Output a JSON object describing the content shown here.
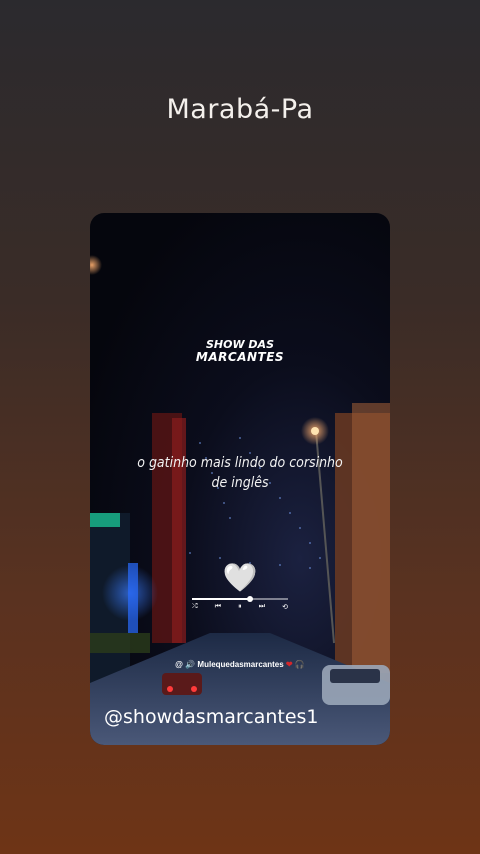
{
  "location": "Marabá-Pa",
  "post": {
    "logo_line1": "SHOW DAS",
    "logo_line2": "MARCANTES",
    "lyric_line1": "o gatinho mais lindo do corsinho",
    "lyric_line2": "de inglês",
    "heart_icon": "🤍",
    "player": {
      "progress": 0.6,
      "controls": [
        "shuffle-icon",
        "previous-icon",
        "pause-icon",
        "next-icon",
        "repeat-icon"
      ]
    },
    "handle_prefix": "@",
    "handle": "Mulequedasmarcantes",
    "watermark": "@showdasmarcantes1"
  },
  "colors": {
    "background_top": "#2b2a2e",
    "background_bottom": "#6e3416",
    "accent_red": "#d4262a"
  }
}
